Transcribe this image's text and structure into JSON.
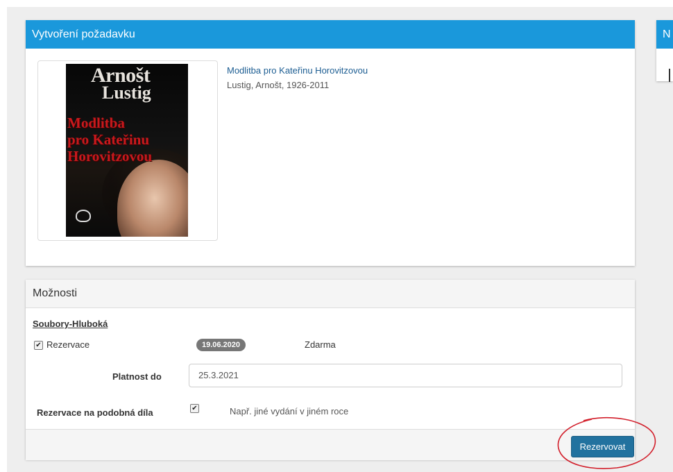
{
  "request_panel": {
    "heading": "Vytvoření požadavku",
    "cover": {
      "author_line1": "Arnošt",
      "author_line2": "Lustig",
      "title_lines": [
        "Modlitba",
        "pro Kateřinu",
        "Horovitzovou"
      ]
    },
    "book_title": "Modlitba pro Kateřinu Horovitzovou",
    "book_author": "Lustig, Arnošt, 1926-2011"
  },
  "side_panel": {
    "heading": "N"
  },
  "options_panel": {
    "heading": "Možnosti",
    "branch_link": "Soubory-Hluboká",
    "reservation_label": "Rezervace",
    "reservation_checked": true,
    "date_badge": "19.06.2020",
    "price": "Zdarma",
    "valid_until_label": "Platnost do",
    "valid_until_value": "25.3.2021",
    "similar_label": "Rezervace na podobná díla",
    "similar_checked": true,
    "similar_hint": "Např. jiné vydání v jiném roce",
    "reserve_button": "Rezervovat"
  },
  "colors": {
    "heading_blue": "#1a98db",
    "button_blue": "#22729f",
    "annotation_red": "#d21f2b",
    "badge_gray": "#777777"
  }
}
